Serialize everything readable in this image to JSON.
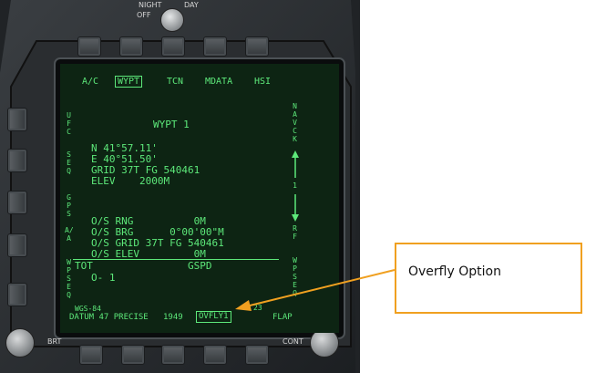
{
  "bezel": {
    "night_label": "NIGHT",
    "day_label": "DAY",
    "off_label": "OFF",
    "brt_label": "BRT",
    "cont_label": "CONT"
  },
  "ddi": {
    "top_options": [
      "A/C",
      "WYPT",
      "TCN",
      "MDATA",
      "HSI"
    ],
    "left_options": [
      "UFC",
      "SEQ",
      "GPS",
      "A/A",
      "WP SEQ"
    ],
    "right_options": [
      "NAV CK",
      "1",
      "RF",
      "WP SEQ"
    ],
    "waypoint_title": "WYPT 1",
    "lat": "N 41°57.11'",
    "lon": "E 40°51.50'",
    "grid": "GRID 37T FG 540461",
    "elev": "ELEV    2000M",
    "os_rng": "O/S RNG          0M",
    "os_brg": "O/S BRG      0°00'00\"M",
    "os_grid": "O/S GRID 37T FG 540461",
    "os_elev": "O/S ELEV         0M",
    "tot_label": "TOT",
    "gspd_label": "GSPD",
    "tot_value": "O- 1",
    "datum_line1": "WGS-84",
    "datum_line2": "DATUM 47 PRECISE",
    "year": "1949",
    "ovfly": "OVFLY1",
    "flap": "FLAP",
    "small_num": "23"
  },
  "callout": {
    "text": "Overfly Option"
  },
  "colors": {
    "screen_text": "#5de87a",
    "screen_bg": "#0d2413",
    "callout_border": "#f0a020",
    "arrow": "#f0a020"
  }
}
